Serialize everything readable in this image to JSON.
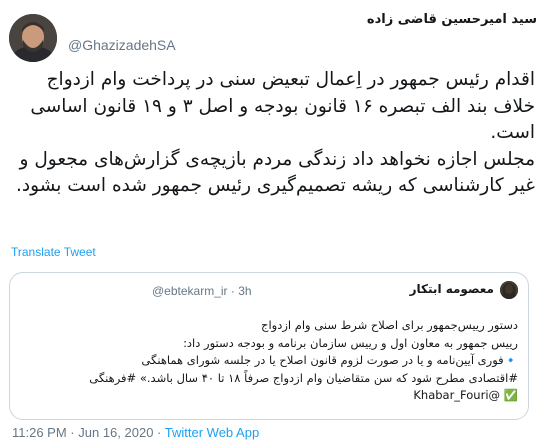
{
  "author": {
    "display_name": "سید امیرحسین قاضی زاده",
    "handle": "@GhazizadehSA"
  },
  "tweet": {
    "paragraph_1": "اقدام رئیس جمهور در اِعمال تبعیض سنی در پرداخت وام ازدواج خلاف بند الف تبصره ۱۶ قانون بودجه و اصل ۳ و ۱۹ قانون اساسی است.",
    "paragraph_2": "مجلس اجازه نخواهد داد زندگی مردم بازیچه‌ی گزارش‌های مجعول و غیر کارشناسی که ریشه تصمیم‌گیری رئیس جمهور شده است بشود."
  },
  "translate_label": "Translate Tweet",
  "quote": {
    "display_name": "معصومه ابتکار",
    "handle": "@ebtekarm_ir",
    "separator": "·",
    "time": "3h",
    "lines": [
      "دستور رییس‌جمهور برای اصلاح شرط سنی وام ازدواج",
      "رییس جمهور به معاون اول و رییس سازمان برنامه و بودجه دستور داد:",
      "🔹فوری آیین‌نامه و یا در صورت لزوم قانون اصلاح یا در جلسه شورای هماهنگی",
      "#اقتصادی مطرح شود که سن متقاضیان  وام ازدواج صرفاً ۱۸ تا ۴۰ سال باشد.» #فرهنگی",
      "✅ @Khabar_Fouri"
    ]
  },
  "footer": {
    "time": "11:26 PM",
    "separator_1": " · ",
    "date": "Jun 16, 2020",
    "separator_2": " · ",
    "app": "Twitter Web App"
  },
  "colors": {
    "link": "#1da1f2",
    "muted": "#657786",
    "border": "#ccd6dd"
  }
}
